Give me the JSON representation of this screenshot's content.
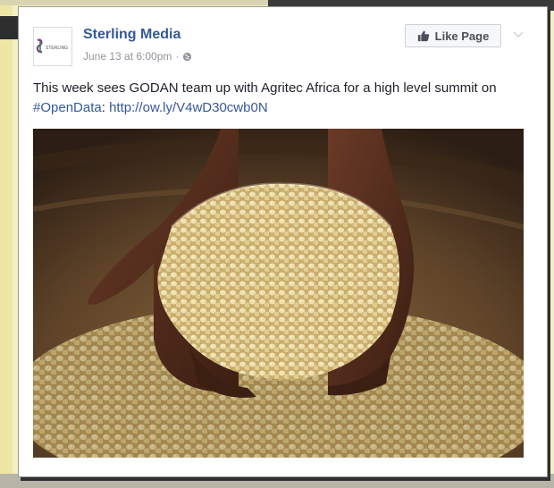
{
  "post": {
    "page_name": "Sterling Media",
    "timestamp": "June 13 at 6:00pm",
    "separator": "·",
    "avatar_text": "STERLING",
    "like_button_label": "Like Page",
    "text": "This week sees GODAN team up with Agritec Africa for a high level summit on ",
    "hashtag": "#OpenData",
    "colon": ":",
    "link": "http://ow.ly/V4wD30cwb0N"
  },
  "icons": {
    "like": "thumbs-up-icon",
    "privacy": "globe-icon",
    "menu": "chevron-down-icon"
  },
  "colors": {
    "link": "#365899",
    "text": "#1d2129",
    "meta": "#90949c",
    "button_bg": "#f6f7f9"
  }
}
